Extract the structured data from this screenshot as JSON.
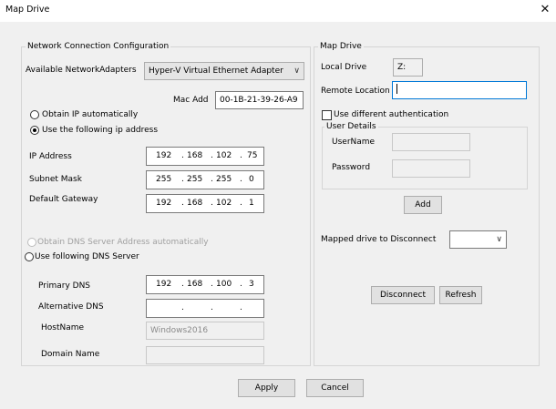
{
  "window": {
    "title": "Map Drive",
    "close_glyph": "✕"
  },
  "network": {
    "legend": "Network Connection Configuration",
    "adapters_label": "Available NetworkAdapters",
    "adapter_selected": "Hyper-V Virtual Ethernet Adapter",
    "mac_label": "Mac Add",
    "mac_value": "00-1B-21-39-26-A9",
    "obtain_ip_auto": "Obtain IP automatically",
    "use_following_ip": "Use the following ip address",
    "ip_address_label": "IP Address",
    "ip_address": [
      "192",
      "168",
      "102",
      "75"
    ],
    "subnet_label": "Subnet Mask",
    "subnet": [
      "255",
      "255",
      "255",
      "0"
    ],
    "gateway_label": "Default Gateway",
    "gateway": [
      "192",
      "168",
      "102",
      "1"
    ],
    "obtain_dns_auto": "Obtain DNS Server Address automatically",
    "use_following_dns": "Use following DNS Server",
    "primary_dns_label": "Primary DNS",
    "primary_dns": [
      "192",
      "168",
      "100",
      "3"
    ],
    "alt_dns_label": "Alternative DNS",
    "alt_dns": [
      "",
      "",
      "",
      ""
    ],
    "hostname_label": "HostName",
    "hostname_value": "Windows2016",
    "domain_label": "Domain Name",
    "domain_value": ""
  },
  "map": {
    "legend": "Map Drive",
    "local_drive_label": "Local Drive",
    "local_drive_value": "Z:",
    "remote_location_label": "Remote Location",
    "remote_location_value": "",
    "use_diff_auth": "Use different authentication",
    "user_details_legend": "User Details",
    "username_label": "UserName",
    "password_label": "Password",
    "add_button": "Add",
    "mapped_disconnect_label": "Mapped drive to Disconnect",
    "mapped_disconnect_value": "",
    "disconnect_button": "Disconnect",
    "refresh_button": "Refresh"
  },
  "footer": {
    "apply_button": "Apply",
    "cancel_button": "Cancel"
  },
  "icons": {
    "dropdown": "chevron-down-icon",
    "close": "close-icon"
  }
}
